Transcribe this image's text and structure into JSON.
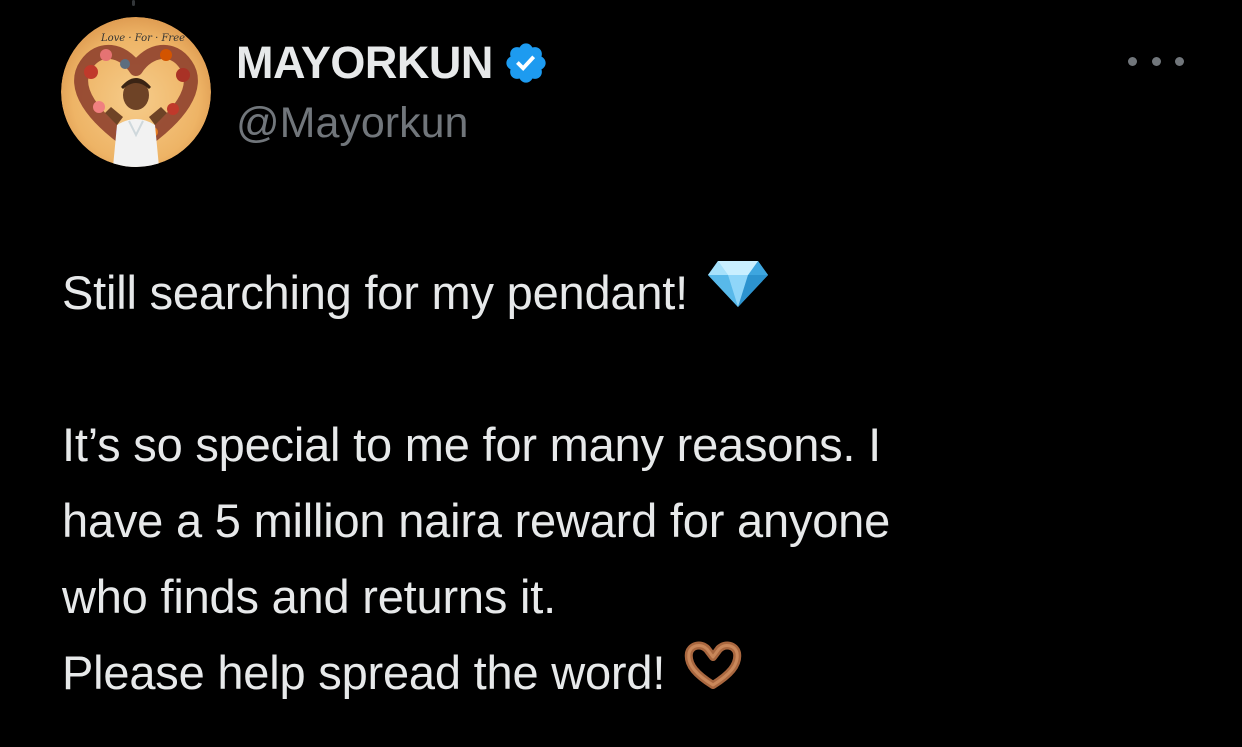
{
  "author": {
    "display_name": "MAYORKUN",
    "handle": "@Mayorkun",
    "verified": true,
    "avatar_icon": "profile-photo",
    "avatar_caption": "Love · For · Free"
  },
  "tweet": {
    "paragraph_1": "Still searching for my pendant!",
    "paragraph_1_emoji": "gem-stone",
    "paragraph_2_lines": [
      "It’s so special to me for many reasons. I",
      "have a 5 million naira reward for anyone",
      "who finds and returns it."
    ],
    "paragraph_3": "Please help spread the word!",
    "paragraph_3_emoji": "heart-hands"
  },
  "colors": {
    "background": "#000000",
    "text": "#e7e9ea",
    "secondary_text": "#71767b",
    "verified_badge": "#1d9bf0"
  },
  "icons": {
    "more": "more-dots-icon",
    "verified": "verified-badge-icon"
  }
}
